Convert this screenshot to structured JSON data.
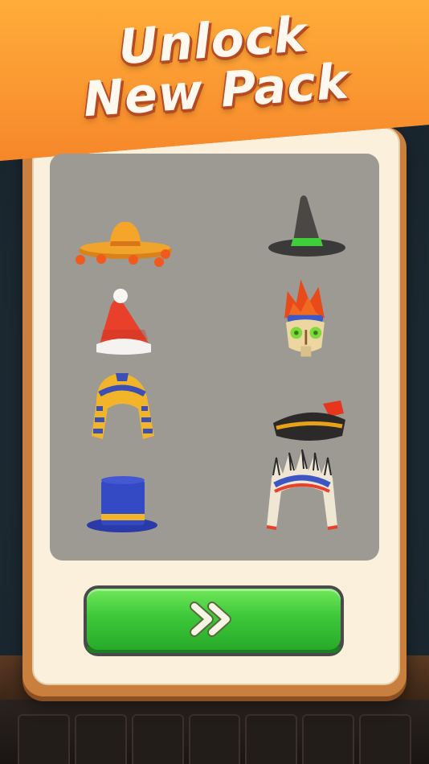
{
  "banner": {
    "title": "Unlock\nNew Pack"
  },
  "pack": {
    "items": [
      {
        "name": "sombrero",
        "icon": "sombrero-hat-icon"
      },
      {
        "name": "witch-hat",
        "icon": "witch-hat-icon"
      },
      {
        "name": "santa-hat",
        "icon": "santa-hat-icon"
      },
      {
        "name": "tribal-mask",
        "icon": "tribal-skull-mask-icon"
      },
      {
        "name": "pharaoh-headdress",
        "icon": "pharaoh-headdress-icon"
      },
      {
        "name": "pirate-hat",
        "icon": "pirate-hat-icon"
      },
      {
        "name": "top-hat",
        "icon": "top-hat-icon"
      },
      {
        "name": "feather-headdress",
        "icon": "feather-headdress-icon"
      }
    ]
  },
  "colors": {
    "banner": "#f6872a",
    "panel": "#fbf0dc",
    "grid": "#9d9a94",
    "button": "#3ec83a"
  },
  "continue_button": {
    "icon": "double-chevron-right-icon"
  }
}
